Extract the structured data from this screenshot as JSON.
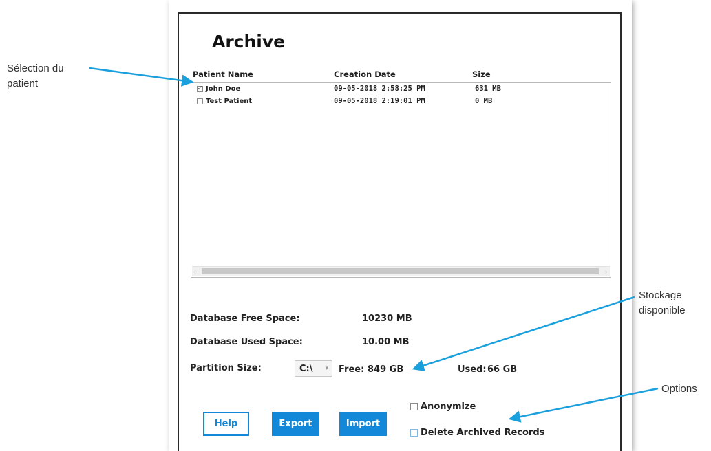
{
  "archive": {
    "title": "Archive",
    "columns": {
      "name": "Patient Name",
      "date": "Creation Date",
      "size": "Size"
    },
    "patients": [
      {
        "name": "John Doe",
        "date": "09-05-2018 2:58:25 PM",
        "size": "631 MB",
        "checked": true
      },
      {
        "name": "Test Patient",
        "date": "09-05-2018 2:19:01 PM",
        "size": "0 MB",
        "checked": false
      }
    ],
    "db_free_label": "Database Free Space:",
    "db_free_value": "10230 MB",
    "db_used_label": "Database Used Space:",
    "db_used_value": "10.00 MB",
    "partition_label": "Partition Size:",
    "partition_drive": "C:\\",
    "free_label": "Free:",
    "free_value": "849 GB",
    "used_label": "Used:",
    "used_value": "66 GB",
    "buttons": {
      "help": "Help",
      "export": "Export",
      "import": "Import"
    },
    "options": {
      "anonymize": "Anonymize",
      "delete_archived": "Delete Archived Records"
    }
  },
  "annotations": {
    "patient_selection": [
      "Sélection du",
      "patient"
    ],
    "storage": [
      "Stockage",
      "disponible"
    ],
    "options": "Options"
  },
  "colors": {
    "accent": "#1488d8",
    "annotation_arrow": "#1aa0dc"
  }
}
